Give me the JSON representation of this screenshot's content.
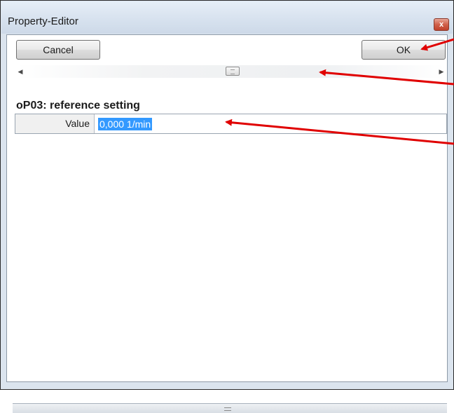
{
  "window": {
    "title": "Property-Editor",
    "close_label": "x"
  },
  "toolbar": {
    "cancel_label": "Cancel",
    "ok_label": "OK"
  },
  "scrollbar": {
    "left_arrow": "<",
    "right_arrow": ">"
  },
  "section": {
    "title": "oP03: reference setting"
  },
  "property": {
    "label": "Value",
    "value": "0,000 1/min"
  },
  "colors": {
    "selection": "#3399ff",
    "annotation_arrow": "#e00000"
  }
}
